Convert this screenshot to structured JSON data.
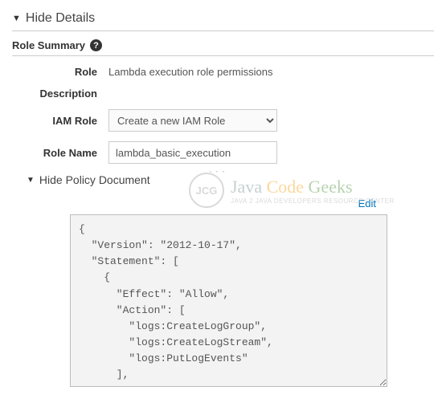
{
  "header": {
    "title": "Hide Details"
  },
  "summary": {
    "title": "Role Summary"
  },
  "form": {
    "role_label": "Role",
    "role_value": "Lambda execution role permissions",
    "description_label": "Description",
    "iam_label": "IAM Role",
    "iam_selected": "Create a new IAM Role",
    "rolename_label": "Role Name",
    "rolename_value": "lambda_basic_execution"
  },
  "policy": {
    "toggle_label": "Hide Policy Document",
    "edit_label": "Edit",
    "document": "{\n  \"Version\": \"2012-10-17\",\n  \"Statement\": [\n    {\n      \"Effect\": \"Allow\",\n      \"Action\": [\n        \"logs:CreateLogGroup\",\n        \"logs:CreateLogStream\",\n        \"logs:PutLogEvents\"\n      ],"
  },
  "watermark": {
    "badge": "JCG",
    "line1a": "Java ",
    "line1b": "Code ",
    "line1c": "Geeks",
    "line2": "Java 2 Java Developers Resource Center"
  }
}
